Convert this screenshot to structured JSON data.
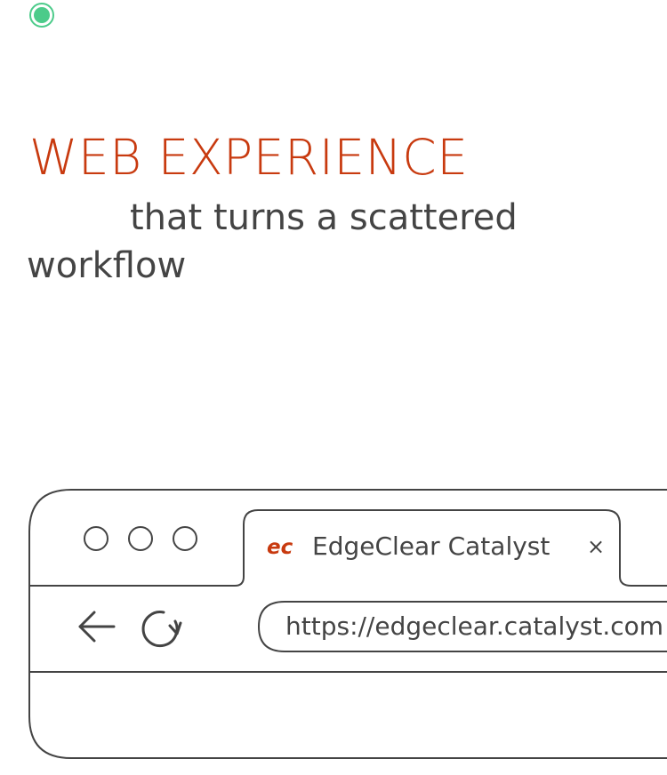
{
  "colors": {
    "accent": "#c83a0f",
    "status": "#4ccb8a",
    "text": "#444444",
    "outline": "#444444"
  },
  "headline": "WEB EXPERIENCE",
  "subhead": "that turns a scattered workflow",
  "browser": {
    "tab": {
      "favicon": "ec",
      "title": "EdgeClear Catalyst",
      "close": "×"
    },
    "url": "https://edgeclear.catalyst.com"
  },
  "icons": {
    "status": "status-dot-icon",
    "back": "arrow-left-icon",
    "reload": "reload-icon",
    "close": "close-icon",
    "favicon": "edgeclear-logo-icon"
  }
}
